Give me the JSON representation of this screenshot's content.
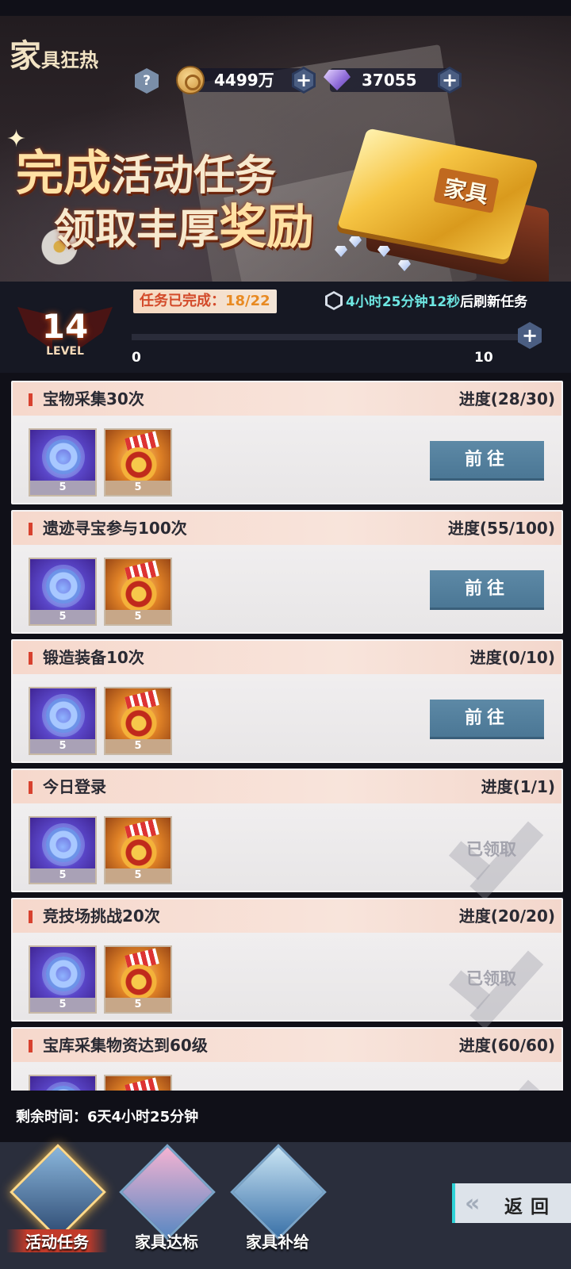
{
  "header": {
    "logo_big": "家",
    "logo_small": "具狂热",
    "help_glyph": "?",
    "gold_amount": "4499万",
    "gem_amount": "37055"
  },
  "banner": {
    "headline_line1_a": "完成",
    "headline_line1_b": "活动任务",
    "headline_line2_a": "领取丰厚",
    "headline_line2_b": "奖励",
    "ticket_label": "家具"
  },
  "level": {
    "number": "14",
    "label": "LEVEL",
    "tasks_done_label": "任务已完成：",
    "tasks_done_value": "18/22",
    "refresh_time": "4小时25分钟12秒",
    "refresh_suffix": "后刷新任务",
    "progress_min": "0",
    "progress_max": "10",
    "progress_value": 0
  },
  "tasks": [
    {
      "title": "宝物采集30次",
      "progress": "进度(28/30)",
      "reward1": "5",
      "reward2": "5",
      "action": "前往",
      "state": "go"
    },
    {
      "title": "遗迹寻宝参与100次",
      "progress": "进度(55/100)",
      "reward1": "5",
      "reward2": "5",
      "action": "前往",
      "state": "go"
    },
    {
      "title": "锻造装备10次",
      "progress": "进度(0/10)",
      "reward1": "5",
      "reward2": "5",
      "action": "前往",
      "state": "go"
    },
    {
      "title": "今日登录",
      "progress": "进度(1/1)",
      "reward1": "5",
      "reward2": "5",
      "action": "已领取",
      "state": "claimed"
    },
    {
      "title": "竞技场挑战20次",
      "progress": "进度(20/20)",
      "reward1": "5",
      "reward2": "5",
      "action": "已领取",
      "state": "claimed"
    },
    {
      "title": "宝库采集物资达到60级",
      "progress": "进度(60/60)",
      "reward1": "",
      "reward2": "",
      "action": "",
      "state": "claimed"
    }
  ],
  "footer": {
    "remaining_label": "剩余时间：",
    "remaining_value": "6天4小时25分钟",
    "tabs": [
      {
        "label": "活动任务",
        "active": true
      },
      {
        "label": "家具达标",
        "active": false
      },
      {
        "label": "家具补给",
        "active": false
      }
    ],
    "back_label": "返回"
  },
  "colors": {
    "accent_red": "#d8412e",
    "go_button": "#5d89a6",
    "timer_cyan": "#6ee6e2",
    "done_value_orange": "#e88a22"
  }
}
